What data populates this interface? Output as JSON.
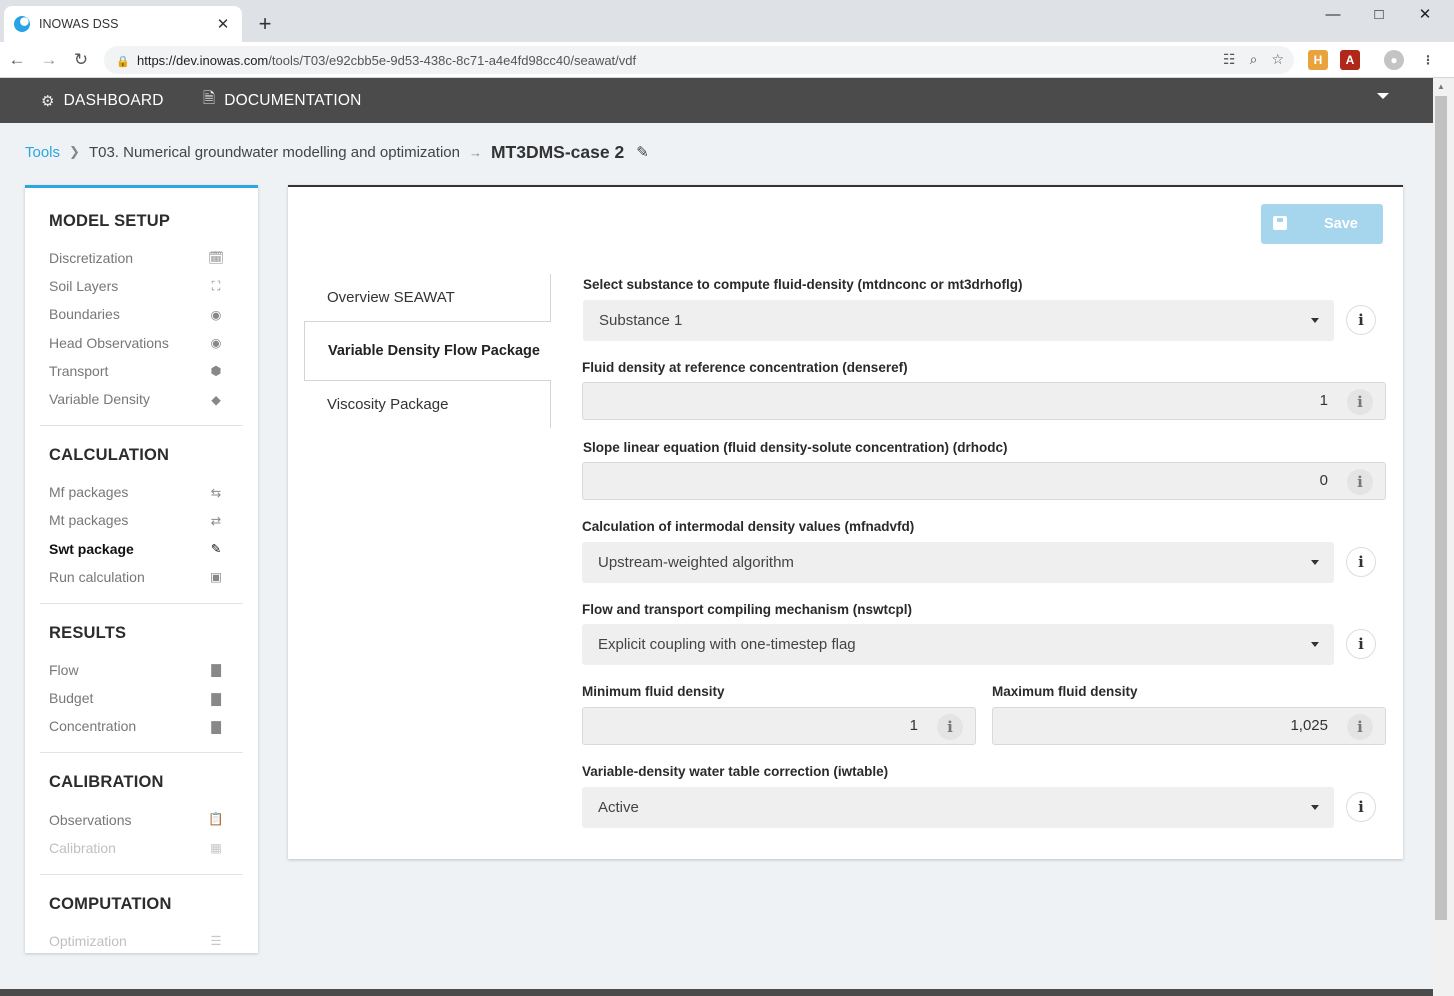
{
  "browser": {
    "tab_title": "INOWAS DSS",
    "tab_close": "✕",
    "new_tab": "+",
    "url_host": "https://dev.inowas.com",
    "url_path": "/tools/T03/e92cbb5e-9d53-438c-8c71-a4e4fd98cc40/seawat/vdf"
  },
  "appnav": {
    "dashboard": "DASHBOARD",
    "documentation": "DOCUMENTATION"
  },
  "breadcrumb": {
    "tools": "Tools",
    "tool": "T03. Numerical groundwater modelling and optimization",
    "current": "MT3DMS-case 2"
  },
  "sidebar": {
    "model_setup": {
      "title": "MODEL SETUP",
      "items": [
        {
          "label": "Discretization",
          "icon": "calendar-icon"
        },
        {
          "label": "Soil Layers",
          "icon": "expand-icon"
        },
        {
          "label": "Boundaries",
          "icon": "map-marker-icon"
        },
        {
          "label": "Head Observations",
          "icon": "eye-icon"
        },
        {
          "label": "Transport",
          "icon": "cube-icon"
        },
        {
          "label": "Variable Density",
          "icon": "diamond-icon"
        }
      ]
    },
    "calculation": {
      "title": "CALCULATION",
      "items": [
        {
          "label": "Mf packages",
          "icon": "retweet-icon"
        },
        {
          "label": "Mt packages",
          "icon": "exchange-icon"
        },
        {
          "label": "Swt package",
          "icon": "eyedropper-icon"
        },
        {
          "label": "Run calculation",
          "icon": "save-icon"
        }
      ]
    },
    "results": {
      "title": "RESULTS",
      "items": [
        {
          "label": "Flow",
          "icon": "bar-chart-icon"
        },
        {
          "label": "Budget",
          "icon": "bar-chart-icon"
        },
        {
          "label": "Concentration",
          "icon": "bar-chart-icon"
        }
      ]
    },
    "calibration": {
      "title": "CALIBRATION",
      "items": [
        {
          "label": "Observations",
          "icon": "clipboard-icon"
        },
        {
          "label": "Calibration",
          "icon": "calculator-icon"
        }
      ]
    },
    "computation": {
      "title": "COMPUTATION",
      "items": [
        {
          "label": "Optimization",
          "icon": "sliders-icon"
        }
      ]
    }
  },
  "panel": {
    "save_label": "Save",
    "tabs": [
      "Overview SEAWAT",
      "Variable Density Flow Package",
      "Viscosity Package"
    ],
    "fields": {
      "substance": {
        "label": "Select substance to compute fluid-density (mtdnconc or mt3drhoflg)",
        "value": "Substance 1"
      },
      "denseref": {
        "label": "Fluid density at reference concentration (denseref)",
        "value": "1"
      },
      "drhodc": {
        "label": "Slope linear equation (fluid density-solute concentration) (drhodc)",
        "value": "0"
      },
      "mfnadvfd": {
        "label": "Calculation of intermodal density values (mfnadvfd)",
        "value": "Upstream-weighted algorithm"
      },
      "nswtcpl": {
        "label": "Flow and transport compiling mechanism (nswtcpl)",
        "value": "Explicit coupling with one-timestep flag"
      },
      "densemin": {
        "label": "Minimum fluid density",
        "value": "1"
      },
      "densemax": {
        "label": "Maximum fluid density",
        "value": "1,025"
      },
      "iwtable": {
        "label": "Variable-density water table correction (iwtable)",
        "value": "Active"
      }
    },
    "info_glyph": "i"
  }
}
